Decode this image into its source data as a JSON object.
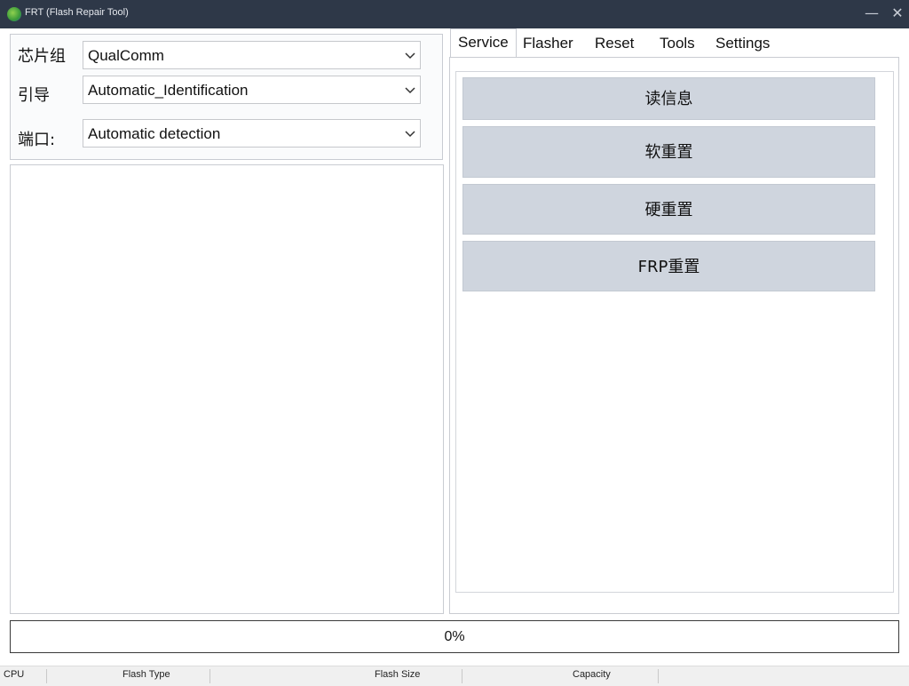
{
  "window": {
    "title": "FRT (Flash Repair Tool)",
    "minimize_glyph": "—",
    "close_glyph": "✕"
  },
  "config": {
    "chipset_label": "芯片组",
    "chipset_value": "QualComm",
    "guide_label": "引导",
    "guide_value": "Automatic_Identification",
    "port_label": "端口:",
    "port_value": "Automatic detection"
  },
  "tabs": [
    {
      "label": "Service"
    },
    {
      "label": "Flasher"
    },
    {
      "label": "Reset"
    },
    {
      "label": "Tools"
    },
    {
      "label": "Settings"
    }
  ],
  "service_buttons": [
    {
      "label": "读信息"
    },
    {
      "label": "软重置"
    },
    {
      "label": "硬重置"
    },
    {
      "label": "FRP重置"
    }
  ],
  "progress": {
    "text": "0%",
    "value": 0
  },
  "status": {
    "cpu": "CPU",
    "flash_type": "Flash Type",
    "flash_size": "Flash Size",
    "capacity": "Capacity"
  },
  "colors": {
    "titlebar_bg": "#2e3848",
    "button_bg": "#cfd5de",
    "progress_fill": "#06b025"
  }
}
